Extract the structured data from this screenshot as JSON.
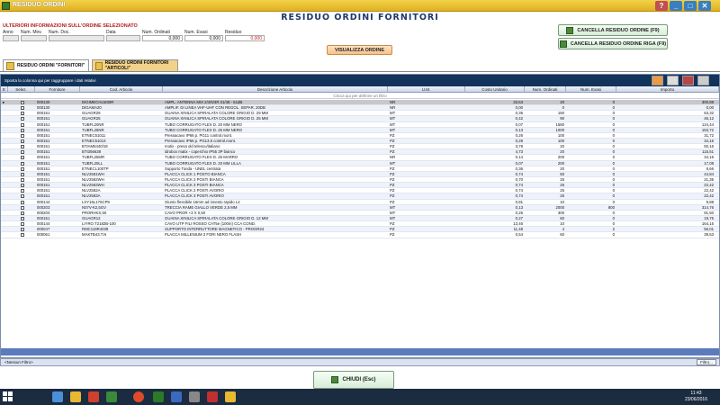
{
  "window": {
    "title": "RESIDUO ORDINI",
    "min": "_",
    "max": "□",
    "close": "✕"
  },
  "page_title": "RESIDUO ORDINI FORNITORI",
  "info": {
    "title": "ULTERIORI INFORMAZIONI SULL'ORDINE SELEZIONATO",
    "labels": [
      "Anno",
      "Num. Mov.",
      "Num. Doc.",
      "Data",
      "Num. Ordinati",
      "Num. Evasi",
      "Residuo"
    ],
    "values": [
      "",
      "",
      "",
      "",
      "0,000",
      "0,000",
      "0,000"
    ]
  },
  "buttons": {
    "cancel_order": "CANCELLA RESIDUO ORDINE (F9)",
    "cancel_row": "CANCELLA RESIDUO ORDINE RIGA (F9)",
    "view_order": "VISUALIZZA ORDINE",
    "close": "CHIUDI (Esc)",
    "filter": "Filtro..."
  },
  "tabs": [
    {
      "label": "RESIDUO ORDINI \"FORNITORI\""
    },
    {
      "label": "RESIDUO ORDINI FORNITORI \"ARTICOLI\""
    }
  ],
  "grid": {
    "group_hint": "Sposta la colonna qui per raggruppare i dati relativi",
    "filter_hint": "Clicca qui per definire un filtro",
    "no_filter": "<Nessun Filtro>",
    "columns": [
      "E",
      "Selez.",
      "Fornitore",
      "Cod. Articolo",
      "Descrizione Articolo",
      "U.M.",
      "Costo Unitario",
      "Num. Ordinati",
      "Num. Evasi",
      "Importo"
    ],
    "rows": [
      [
        "000130",
        "DIGIMECHLM30R",
        "AMPL. ANTENNA MIX 2/4/5/3R 21/48 - 61dB",
        "NR",
        "33,63",
        "20",
        "0",
        "300,88"
      ],
      [
        "000130",
        "DIGAMA20",
        "AMPLIF. DI LINEA VHF-UHF CON REGOL. SEPAR. 20DB",
        "NR",
        "0,00",
        "0",
        "0",
        "0,00"
      ],
      [
        "000151",
        "GUAGR29",
        "GUAINA XINILICA SPIRALATA COLORE GRIGIO D. 29 MM",
        "MT",
        "0,35",
        "150",
        "0",
        "63,32"
      ],
      [
        "000151",
        "GUAGR25",
        "GUAINA XINILICA SPIRALATA COLORE GRIGIO D. 25 MM",
        "MT",
        "0,42",
        "90",
        "0",
        "46,12"
      ],
      [
        "000151",
        "TUBFL20NR",
        "TUBO CORRUGATO FLEX D. 20 MM NERO",
        "MT",
        "0,07",
        "1580",
        "0",
        "124,44"
      ],
      [
        "000151",
        "TUBFL25NR",
        "TUBO CORRUGATO FLEX D. 25 MM NERO",
        "MT",
        "0,13",
        "1000",
        "0",
        "153,72"
      ],
      [
        "000151",
        "ETNEC51011",
        "Pressacavo IP66 p. PG11 control.mont.",
        "PZ",
        "0,26",
        "100",
        "0",
        "31,72"
      ],
      [
        "000151",
        "ETNEC51013",
        "Pressacavo IP66 p. PG13.5 control.mont.",
        "PZ",
        "0,28",
        "100",
        "0",
        "34,16"
      ],
      [
        "000151",
        "BTIAM5440/18",
        "motix - presa old telescu/italiano",
        "PZ",
        "3,78",
        "20",
        "0",
        "92,16"
      ],
      [
        "000151",
        "BTI356638",
        "idrobox matix - coperchio IP55 3P bianco",
        "PZ",
        "4,73",
        "20",
        "0",
        "115,51"
      ],
      [
        "000151",
        "TUBFL25MR",
        "TUBO CORRUGATO FLEX D. 25 MARRO",
        "NR",
        "0,14",
        "200",
        "0",
        "34,16"
      ],
      [
        "000151",
        "TUBFL20LL",
        "TUBO CORRUGATO FLEX D. 20 MM LILLA",
        "MT",
        "0,07",
        "200",
        "0",
        "17,08"
      ],
      [
        "000151",
        "ETNECL100TP",
        "Supporto Tonda - UNEL centrata",
        "PZ",
        "0,36",
        "20",
        "0",
        "8,66"
      ],
      [
        "000151",
        "NLV2581WH",
        "PLACCA CLICK 1 POSTO BIANCA",
        "PZ",
        "0,74",
        "50",
        "0",
        "44,84"
      ],
      [
        "000151",
        "NLV2582WH",
        "PLACCA CLICK 2 POSTI BIANCA",
        "PZ",
        "0,70",
        "25",
        "0",
        "21,35"
      ],
      [
        "000151",
        "NLV2583WH",
        "PLACCA CLICK 3 POSTI BIANCA",
        "PZ",
        "0,74",
        "25",
        "0",
        "22,42"
      ],
      [
        "000151",
        "NLV2582A",
        "PLACCA CLICK 2 POSTI AVORIO",
        "PZ",
        "0,74",
        "25",
        "0",
        "22,42"
      ],
      [
        "000151",
        "NLV2583A",
        "PLACCA CLICK 3 POSTI AVORIO",
        "PZ",
        "0,74",
        "25",
        "0",
        "22,42"
      ],
      [
        "000144",
        "LXY16L176CP9",
        "Giunto flessibile 16mm ad innesto rapido L2",
        "PZ",
        "0,81",
        "10",
        "0",
        "9,88"
      ],
      [
        "000203",
        "N07V-K2,5GV",
        "TRECCIA RAME GIALLO VERDE 2,5 MM",
        "MT",
        "0,13",
        "2000",
        "800",
        "314,76"
      ],
      [
        "000203",
        "PRORHKS,50",
        "CAVO PROR +3 X 0,50",
        "MT",
        "0,25",
        "300",
        "0",
        "91,50"
      ],
      [
        "000151",
        "GUAGR12",
        "GUAINA XINILICA SPIRALATA COLORE GRIGIO D. 12 MM",
        "MT",
        "0,27",
        "60",
        "0",
        "19,76"
      ],
      [
        "000144",
        "LIYRO.T2182B-100",
        "CAVO UTP FILI ROSSO CAT5e (100m) CCA COND.",
        "PZ",
        "13,46",
        "10",
        "0",
        "164,15"
      ],
      [
        "000047",
        "RMC119R4039",
        "SUPPORTO INTERRUTTORE MAGNETICO - PROGR24",
        "PZ",
        "11,48",
        "4",
        "2",
        "56,01"
      ],
      [
        "000061",
        "MAKTB43.T.N",
        "PLACCA MILLENIUM 3 FORI NERO FLASH",
        "PZ",
        "0,54",
        "60",
        "0",
        "39,53"
      ]
    ]
  },
  "taskbar": {
    "time": "11:43",
    "date": "23/06/2016"
  },
  "colors": {
    "header_blue": "#12335c",
    "title_red": "#b02020",
    "titlebar_gold": "#e6bb30"
  }
}
